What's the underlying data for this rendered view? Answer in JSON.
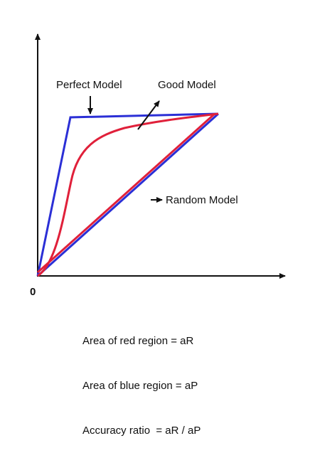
{
  "diagram": {
    "origin_label": "0",
    "labels": {
      "perfect": "Perfect Model",
      "good": "Good Model",
      "random": "Random Model"
    },
    "caption_lines": [
      "Area of red region = aR",
      "Area of blue region = aP",
      "Accuracy ratio  = aR / aP"
    ],
    "colors": {
      "axis": "#111111",
      "perfect_line": "#2b2fd6",
      "model_line": "#e0203a",
      "arrow": "#111111"
    }
  }
}
